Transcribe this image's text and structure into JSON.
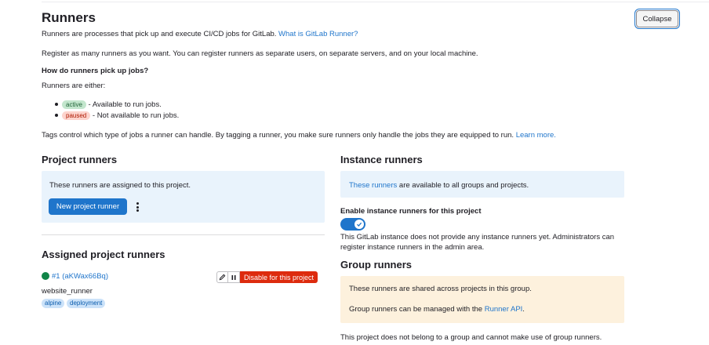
{
  "header": {
    "title": "Runners",
    "collapse_label": "Collapse",
    "intro_text": "Runners are processes that pick up and execute CI/CD jobs for GitLab.",
    "intro_link": "What is GitLab Runner?",
    "register_text": "Register as many runners as you want. You can register runners as separate users, on separate servers, and on your local machine.",
    "pickup_heading": "How do runners pick up jobs?",
    "either_text": "Runners are either:",
    "states": [
      {
        "badge": "active",
        "text": "- Available to run jobs."
      },
      {
        "badge": "paused",
        "text": "- Not available to run jobs."
      }
    ],
    "tags_text": "Tags control which type of jobs a runner can handle. By tagging a runner, you make sure runners only handle the jobs they are equipped to run.",
    "tags_link": "Learn more."
  },
  "project_runners": {
    "title": "Project runners",
    "info_text": "These runners are assigned to this project.",
    "new_button": "New project runner"
  },
  "assigned": {
    "title": "Assigned project runners",
    "runner": {
      "id_label": "#1 (aKWax66Bq)",
      "status": "online",
      "description": "website_runner",
      "tags": [
        "alpine",
        "deployment"
      ],
      "disable_label": "Disable for this project"
    }
  },
  "instance_runners": {
    "title": "Instance runners",
    "info_link": "These runners",
    "info_text": "are available to all groups and projects.",
    "toggle_label": "Enable instance runners for this project",
    "toggle_on": true,
    "note_line1": "This GitLab instance does not provide any instance runners yet. Administrators can",
    "note_line2": "register instance runners in the admin area."
  },
  "group_runners": {
    "title": "Group runners",
    "shared_text": "These runners are shared across projects in this group.",
    "api_text": "Group runners can be managed with the",
    "api_link": "Runner API",
    "api_suffix": ".",
    "footer_text": "This project does not belong to a group and cannot make use of group runners."
  },
  "colors": {
    "primary": "#1f75cb",
    "danger": "#dd2b0e",
    "success": "#108548",
    "info_bg": "#e9f3fc",
    "warning_bg": "#fdf1dd"
  }
}
